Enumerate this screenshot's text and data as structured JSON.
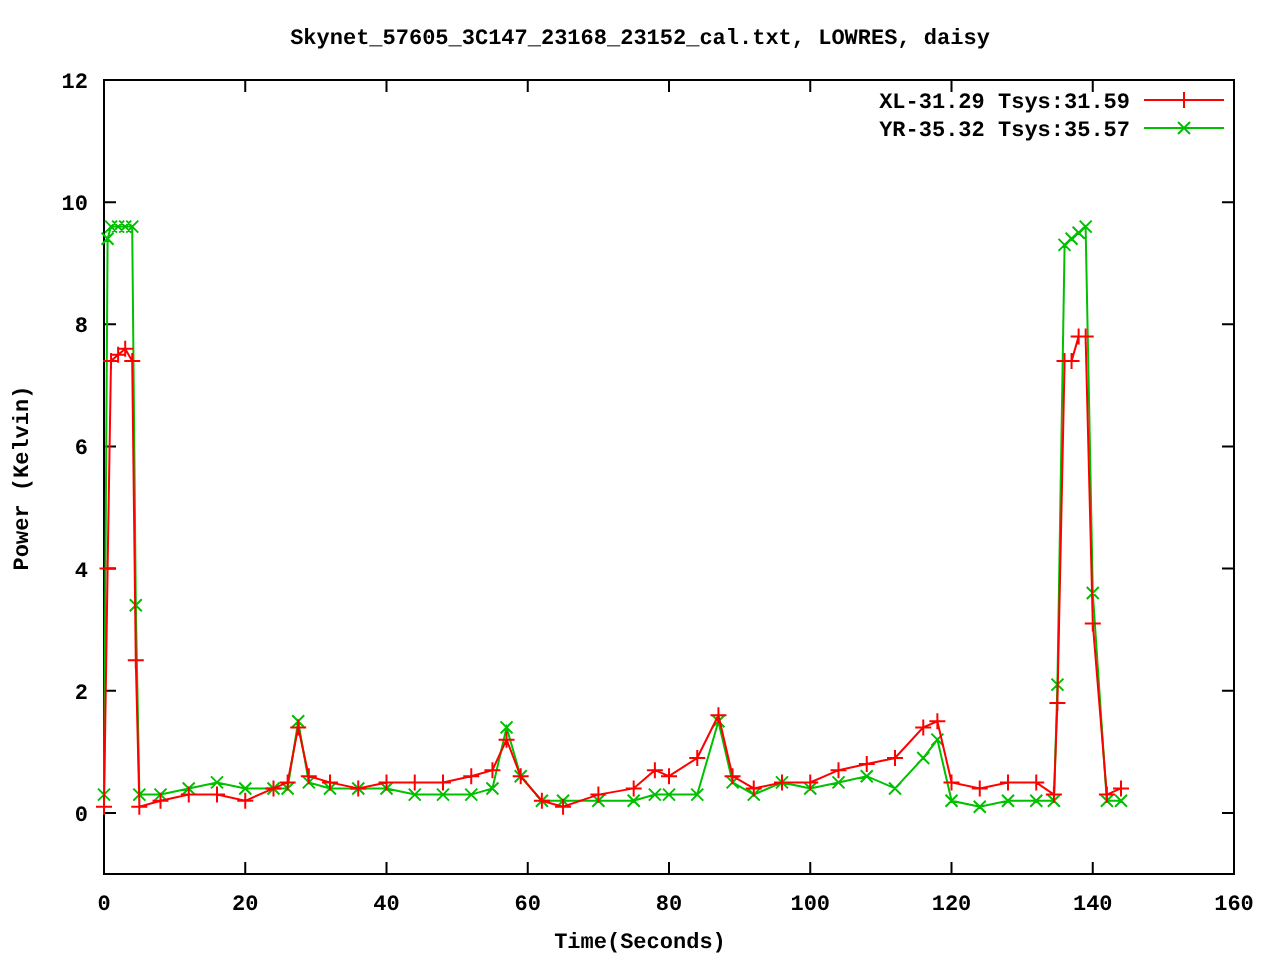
{
  "chart_data": {
    "type": "line",
    "title": "Skynet_57605_3C147_23168_23152_cal.txt, LOWRES, daisy",
    "xlabel": "Time(Seconds)",
    "ylabel": "Power (Kelvin)",
    "x": [
      0,
      0.5,
      1,
      2,
      3,
      4,
      4.5,
      5,
      8,
      12,
      16,
      20,
      24,
      26,
      27.5,
      29,
      32,
      36,
      40,
      44,
      48,
      52,
      55,
      57,
      59,
      62,
      65,
      70,
      75,
      78,
      80,
      84,
      87,
      89,
      92,
      96,
      100,
      104,
      108,
      112,
      116,
      118,
      120,
      124,
      128,
      132,
      134.5,
      135,
      136,
      137,
      138,
      139,
      140,
      142,
      144
    ],
    "legend": "upper right",
    "series": [
      {
        "name": "XL-31.29 Tsys:31.59",
        "color": "#ff0000",
        "marker": "plus",
        "values": [
          0.1,
          4,
          7.4,
          7.5,
          7.6,
          7.4,
          2.5,
          0.1,
          0.2,
          0.3,
          0.3,
          0.2,
          0.4,
          0.5,
          1.4,
          0.6,
          0.5,
          0.4,
          0.5,
          0.5,
          0.5,
          0.6,
          0.7,
          1.2,
          0.6,
          0.2,
          0.1,
          0.3,
          0.4,
          0.7,
          0.6,
          0.9,
          1.6,
          0.6,
          0.4,
          0.5,
          0.5,
          0.7,
          0.8,
          0.9,
          1.4,
          1.5,
          0.5,
          0.4,
          0.5,
          0.5,
          0.3,
          1.8,
          7.4,
          7.4,
          7.8,
          7.8,
          3.1,
          0.3,
          0.4
        ]
      },
      {
        "name": "YR-35.32 Tsys:35.57",
        "color": "#00c000",
        "marker": "x",
        "values": [
          0.3,
          9.4,
          9.6,
          9.6,
          9.6,
          9.6,
          3.4,
          0.3,
          0.3,
          0.4,
          0.5,
          0.4,
          0.4,
          0.4,
          1.5,
          0.5,
          0.4,
          0.4,
          0.4,
          0.3,
          0.3,
          0.3,
          0.4,
          1.4,
          0.6,
          0.2,
          0.2,
          0.2,
          0.2,
          0.3,
          0.3,
          0.3,
          1.5,
          0.5,
          0.3,
          0.5,
          0.4,
          0.5,
          0.6,
          0.4,
          0.9,
          1.2,
          0.2,
          0.1,
          0.2,
          0.2,
          0.2,
          2.1,
          9.3,
          9.4,
          9.5,
          9.6,
          3.6,
          0.2,
          0.2
        ]
      }
    ],
    "xlim": [
      0,
      160
    ],
    "ylim": [
      -1,
      12
    ],
    "xticks": [
      0,
      20,
      40,
      60,
      80,
      100,
      120,
      140,
      160
    ],
    "yticks": [
      0,
      2,
      4,
      6,
      8,
      10,
      12
    ]
  }
}
